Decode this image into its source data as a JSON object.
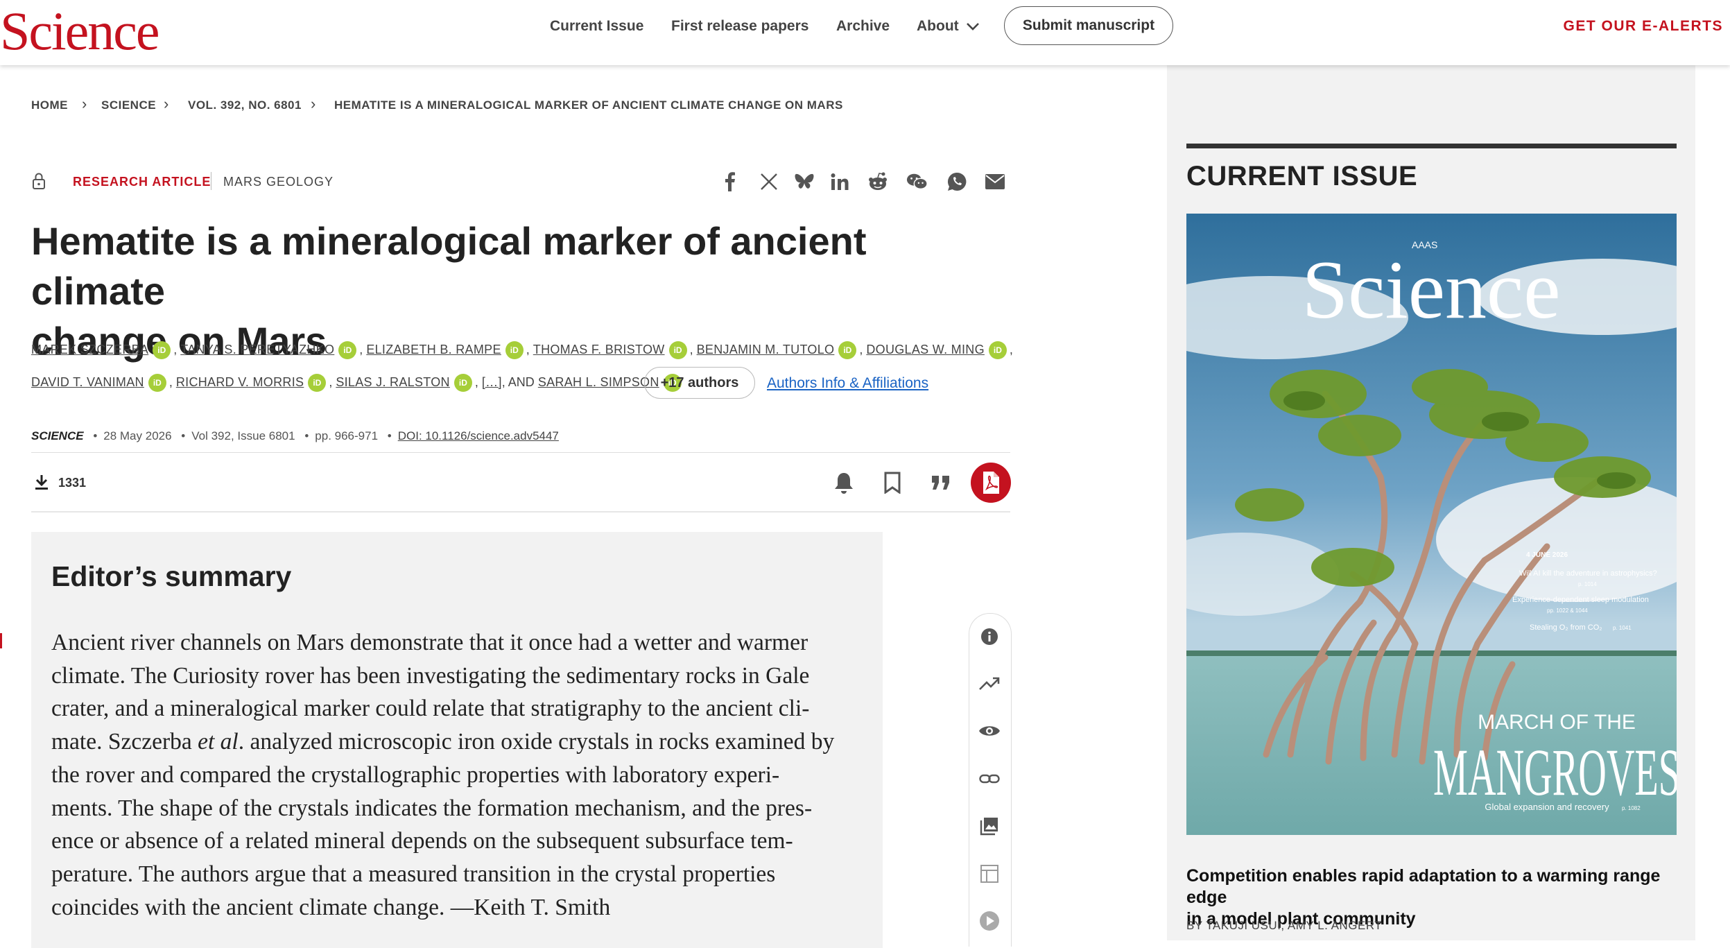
{
  "header": {
    "logo": "Science",
    "nav": [
      "Current Issue",
      "First release papers",
      "Archive",
      "About"
    ],
    "submit_label": "Submit manuscript",
    "ealerts": "GET OUR E-ALERTS"
  },
  "breadcrumb": [
    "HOME",
    "SCIENCE",
    "VOL. 392, NO. 6801",
    "HEMATITE IS A MINERALOGICAL MARKER OF ANCIENT CLIMATE CHANGE ON MARS"
  ],
  "article": {
    "type": "RESEARCH ARTICLE",
    "subject": "MARS GEOLOGY",
    "title_line1": "Hematite is a mineralogical marker of ancient climate",
    "title_line2": "change on Mars",
    "authors_row1": [
      "MAREK SZCZERBA",
      "TANYA S. PERETYAZHKO",
      "ELIZABETH B. RAMPE",
      "THOMAS F. BRISTOW",
      "BENJAMIN M. TUTOLO",
      "DOUGLAS W. MING"
    ],
    "authors_row2": [
      "DAVID T. VANIMAN",
      "RICHARD V. MORRIS",
      "SILAS J. RALSTON"
    ],
    "ellipsis": "[…]",
    "and_label": ", AND",
    "last_author": "SARAH L. SIMPSON",
    "more_authors": "+17 authors",
    "affiliations_link": "Authors Info & Affiliations",
    "journal": "SCIENCE",
    "date": "28 May 2026",
    "volume": "Vol 392, Issue 6801",
    "pages": "pp. 966-971",
    "doi": "DOI: 10.1126/science.adv5447",
    "downloads": "1331"
  },
  "icons": {
    "share": [
      "facebook-icon",
      "x-icon",
      "bluesky-icon",
      "linkedin-icon",
      "reddit-icon",
      "wechat-icon",
      "whatsapp-icon",
      "email-icon"
    ],
    "tools": [
      "bell-icon",
      "bookmark-icon",
      "quote-icon",
      "pdf-icon"
    ],
    "side": [
      "info-icon",
      "trending-icon",
      "eye-icon",
      "link-icon",
      "image-icon",
      "table-icon",
      "play-icon"
    ]
  },
  "summary": {
    "heading": "Editor’s summary",
    "lines": [
      "Ancient river channels on Mars demonstrate that it once had a wetter and warmer",
      "climate. The Curiosity rover has been investigating the sedimentary rocks in Gale",
      "crater, and a mineralogical marker could relate that stratigraphy to the ancient cli-",
      "mate. Szczerba ",
      "ments. The shape of the crystals indicates the formation mechanism, and the pres-",
      "ence or absence of a related mineral depends on the subsequent subsurface tem-",
      "perature. The authors argue that a measured transition in the crystal properties",
      "coincides with the ancient climate change. —Keith T. Smith"
    ],
    "line4_italic": "et al",
    "line4_rest": ". analyzed microscopic iron oxide crystals in rocks examined by",
    "line5": "the rover and compared the crystallographic properties with laboratory experi-"
  },
  "sidebar": {
    "heading": "CURRENT ISSUE",
    "cover": {
      "publisher": "AAAS",
      "logo": "Science",
      "date": "4 JUNE 2026",
      "teaser1": "Will AI kill the adventure in astrophysics?",
      "teaser1_page": "p. 1014",
      "teaser2": "Experience-dependent sleep modulation",
      "teaser2_page": "pp. 1022 & 1044",
      "teaser3": "Stealing O₂ from CO₂",
      "teaser3_page": "p. 1041",
      "kicker": "MARCH OF THE",
      "headline": "MANGROVES",
      "subline": "Global expansion and recovery",
      "subline_page": "p. 1082"
    },
    "feature_title_line1": "Competition enables rapid adaptation to a warming range edge",
    "feature_title_line2": "in a model plant community",
    "feature_byline": "BY TAKUJI USUI,  AMY L. ANGERT"
  },
  "colors": {
    "brand_red": "#c4121f",
    "orcid_green": "#a6ce39",
    "link_blue": "#1a63c4"
  }
}
